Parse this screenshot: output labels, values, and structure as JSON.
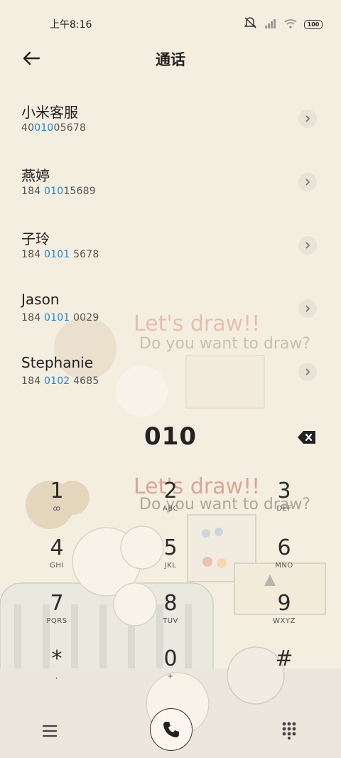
{
  "status_bar": {
    "time": "上午8:16",
    "battery": "100"
  },
  "header": {
    "title": "通话"
  },
  "contacts": [
    {
      "name": "小米客服",
      "num_pre": "40",
      "num_hl": "010",
      "num_post": "05678"
    },
    {
      "name": "燕婷",
      "num_pre": "184 ",
      "num_hl": "010",
      "num_post": "15689"
    },
    {
      "name": "子玲",
      "num_pre": "184 ",
      "num_hl": "0101",
      "num_post": " 5678"
    },
    {
      "name": "Jason",
      "num_pre": "184 ",
      "num_hl": "0101",
      "num_post": " 0029"
    },
    {
      "name": "Stephanie",
      "num_pre": "184 ",
      "num_hl": "0102",
      "num_post": " 4685"
    }
  ],
  "dialer": {
    "input": "010"
  },
  "wallpaper": {
    "text_line1": "Let's draw!!",
    "text_line2": "Do you want to draw?"
  },
  "keys": [
    {
      "digit": "1",
      "letters": "ꝏ"
    },
    {
      "digit": "2",
      "letters": "ABC"
    },
    {
      "digit": "3",
      "letters": "DEF"
    },
    {
      "digit": "4",
      "letters": "GHI"
    },
    {
      "digit": "5",
      "letters": "JKL"
    },
    {
      "digit": "6",
      "letters": "MNO"
    },
    {
      "digit": "7",
      "letters": "PQRS"
    },
    {
      "digit": "8",
      "letters": "TUV"
    },
    {
      "digit": "9",
      "letters": "WXYZ"
    },
    {
      "digit": "*",
      "letters": ","
    },
    {
      "digit": "0",
      "letters": "+"
    },
    {
      "digit": "#",
      "letters": ""
    }
  ],
  "colors": {
    "accent": "#1e88d8",
    "background": "#f4eee0"
  }
}
